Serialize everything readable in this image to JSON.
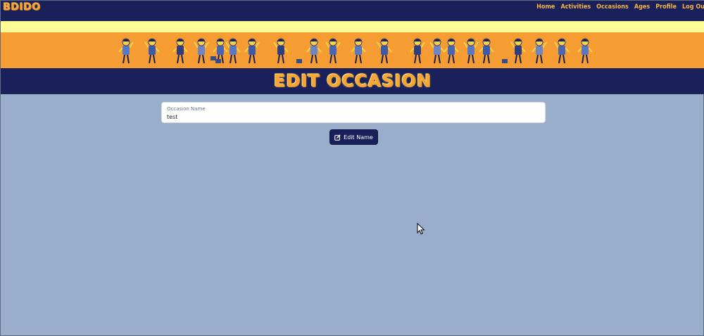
{
  "navbar": {
    "brand": "BDIDO",
    "links": [
      "Home",
      "Activities",
      "Occasions",
      "Ages",
      "Profile",
      "Log Ou"
    ]
  },
  "heading": {
    "title": "EDIT OCCASION"
  },
  "form": {
    "field_label": "Occasion Name",
    "field_value": "test",
    "submit_label": "Edit Name",
    "submit_icon": "edit-icon"
  },
  "colors": {
    "navbar": "#1a215a",
    "accent": "#f7a534",
    "banner": "#f59d32",
    "yellow_stripe": "#fdfd96",
    "page_background": "#99aecb"
  }
}
